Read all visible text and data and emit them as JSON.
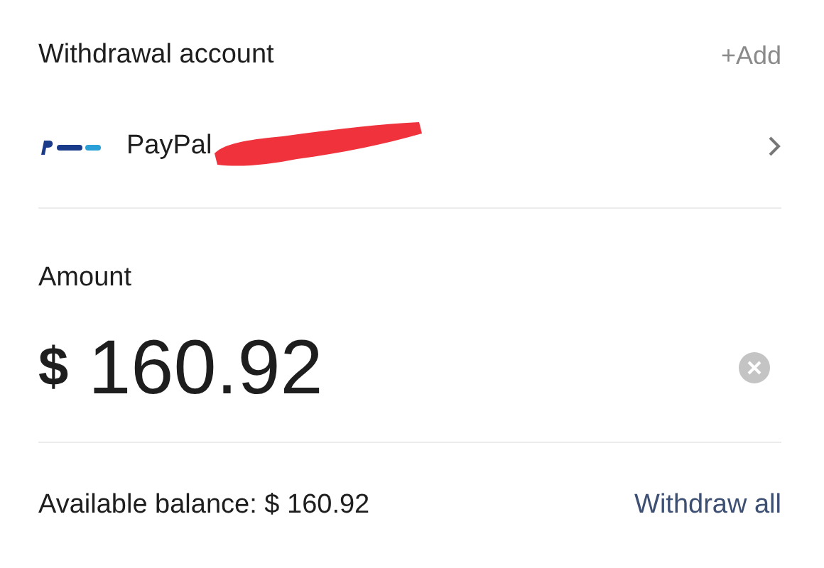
{
  "account_section": {
    "title": "Withdrawal account",
    "add_link": "+Add"
  },
  "account": {
    "name": "PayPal",
    "redacted": true
  },
  "amount_section": {
    "title": "Amount",
    "currency": "$",
    "value": "160.92"
  },
  "footer": {
    "balance": "Available balance: $ 160.92",
    "withdraw_all": "Withdraw all"
  }
}
